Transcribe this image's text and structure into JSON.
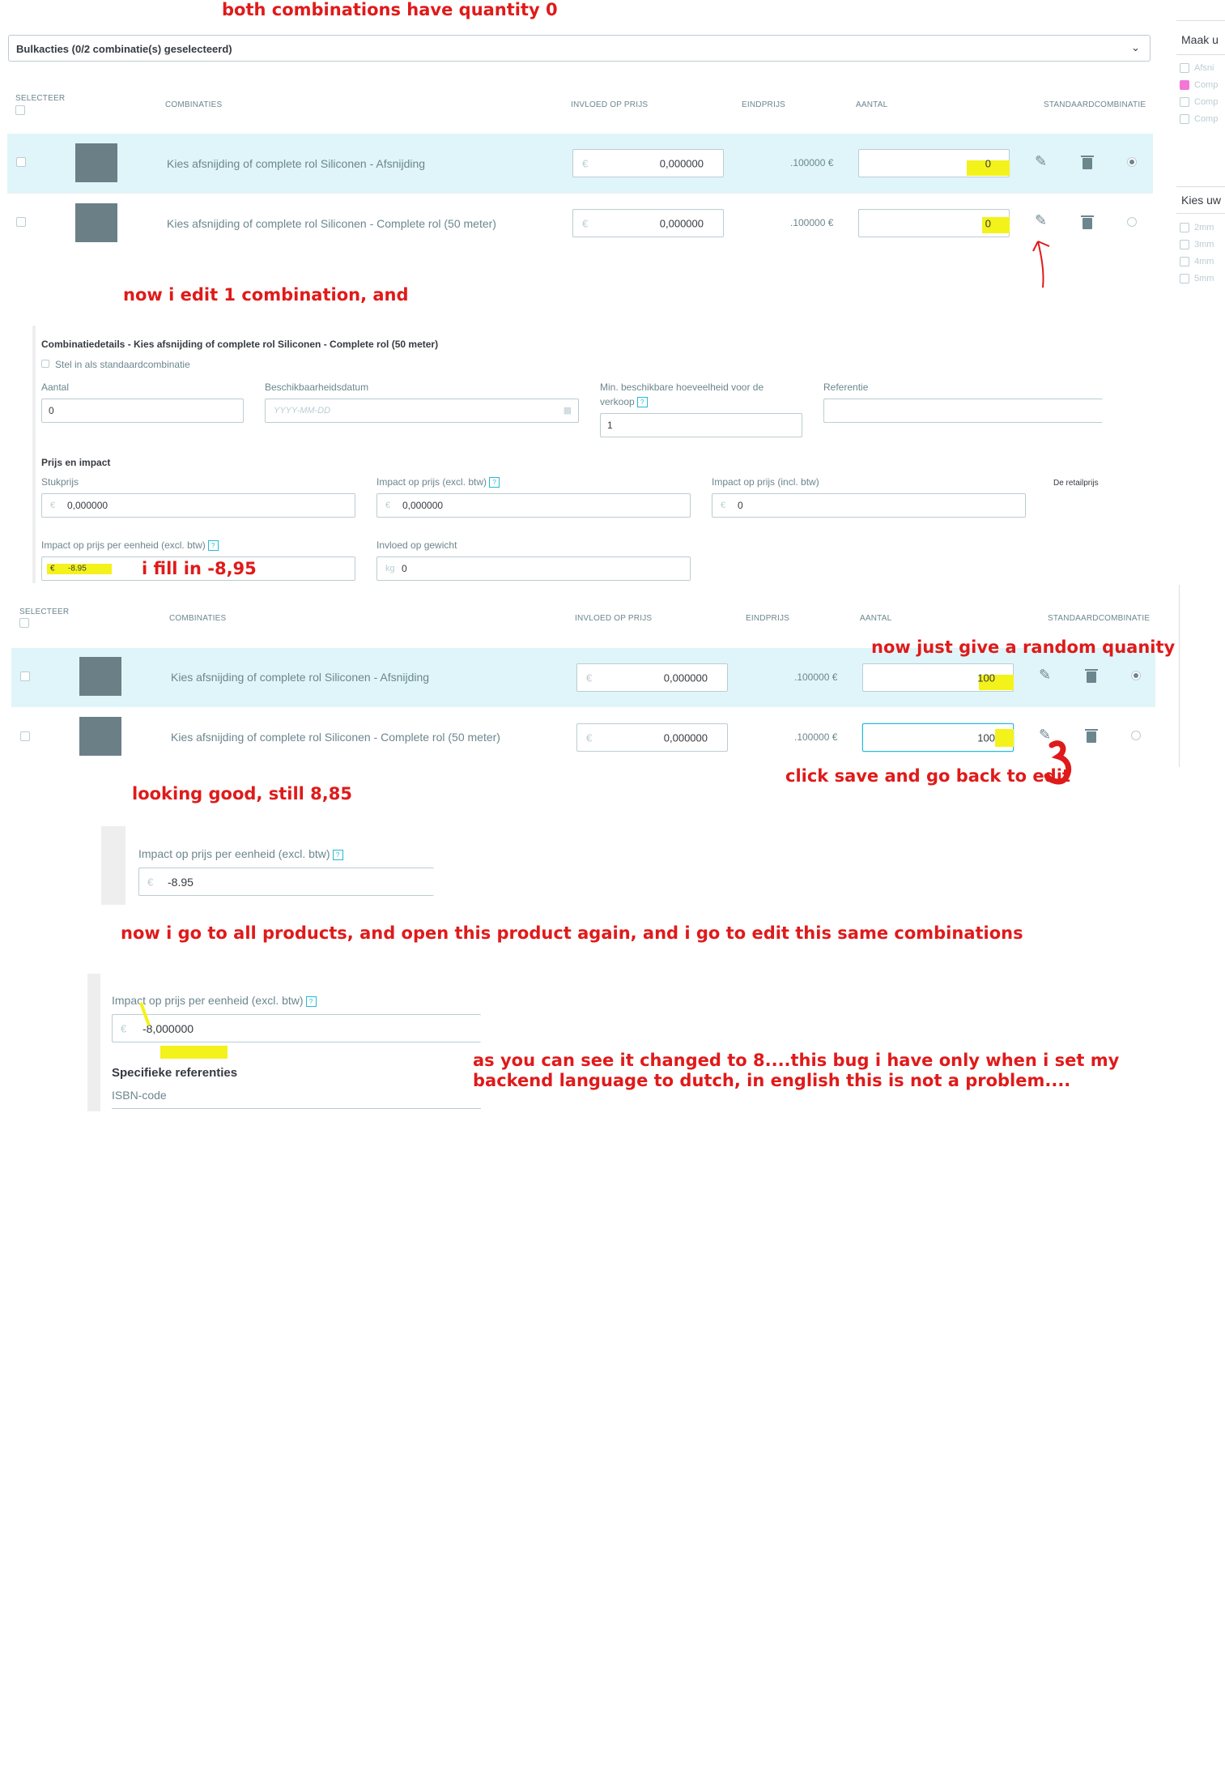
{
  "notes": {
    "n1": "both combinations have quantity 0",
    "n2": "now i edit 1 combination, and",
    "n3": "i fill in -8,95",
    "n4": "now just give a random quanity",
    "n5": "click save and go back to edit",
    "n6": "looking good, still 8,85",
    "n7": "now i go to all products, and open this product again, and i go to edit this same combinations",
    "n8a": "as you can see it changed to 8....this bug i have only when i set my",
    "n8b": "backend language to dutch, in english this is not a problem...."
  },
  "bulk": {
    "label": "Bulkacties (0/2 combinatie(s) geselecteerd)"
  },
  "table": {
    "headers": {
      "select": "SELECTEER",
      "combos": "COMBINATIES",
      "impact": "INVLOED OP PRIJS",
      "final": "EINDPRIJS",
      "qty": "AANTAL",
      "default": "STANDAARDCOMBINATIE"
    },
    "rows": [
      {
        "name": "Kies afsnijding of complete rol Siliconen - Afsnijding",
        "impact": "0,000000",
        "final": ".100000 €",
        "qty": "0"
      },
      {
        "name": "Kies afsnijding of complete rol Siliconen - Complete rol (50 meter)",
        "impact": "0,000000",
        "final": ".100000 €",
        "qty": "0"
      }
    ],
    "rows2": [
      {
        "name": "Kies afsnijding of complete rol Siliconen - Afsnijding",
        "impact": "0,000000",
        "final": ".100000 €",
        "qty": "100"
      },
      {
        "name": "Kies afsnijding of complete rol Siliconen - Complete rol (50 meter)",
        "impact": "0,000000",
        "final": ".100000 €",
        "qty": "100"
      }
    ],
    "currency": "€"
  },
  "sidepanel": {
    "title1": "Maak u",
    "items1": [
      "Afsni",
      "Comp",
      "Comp",
      "Comp"
    ],
    "title2": "Kies uw",
    "items2": [
      "2mm",
      "3mm",
      "4mm",
      "5mm"
    ],
    "accent": "#f277d7"
  },
  "details": {
    "title": "Combinatiedetails - Kies afsnijding of complete rol Siliconen - Complete rol (50 meter)",
    "default_cb": "Stel in als standaardcombinatie",
    "qty_label": "Aantal",
    "qty_value": "0",
    "date_label": "Beschikbaarheidsdatum",
    "date_placeholder": "YYYY-MM-DD",
    "min_label_1": "Min. beschikbare hoeveelheid voor de",
    "min_label_2": "verkoop",
    "min_value": "1",
    "ref_label": "Referentie",
    "price_section": "Prijs en impact",
    "unit_label": "Stukprijs",
    "unit_value": "0,000000",
    "impact_excl_label": "Impact op prijs (excl. btw)",
    "impact_excl_value": "0,000000",
    "impact_incl_label": "Impact op prijs (incl. btw)",
    "impact_incl_value": "0",
    "retail_label": "De retailprijs",
    "unit_impact_label": "Impact op prijs per eenheid (excl. btw)",
    "unit_impact_value": "-8.95",
    "weight_label": "Invloed op gewicht",
    "weight_unit": "kg",
    "weight_value": "0"
  },
  "crop1": {
    "label": "Impact op prijs per eenheid (excl. btw)",
    "value": "-8.95"
  },
  "crop2": {
    "label": "Impact op prijs per eenheid (excl. btw)",
    "value": "-8,000000",
    "section": "Specifieke referenties",
    "isbn": "ISBN-code"
  }
}
